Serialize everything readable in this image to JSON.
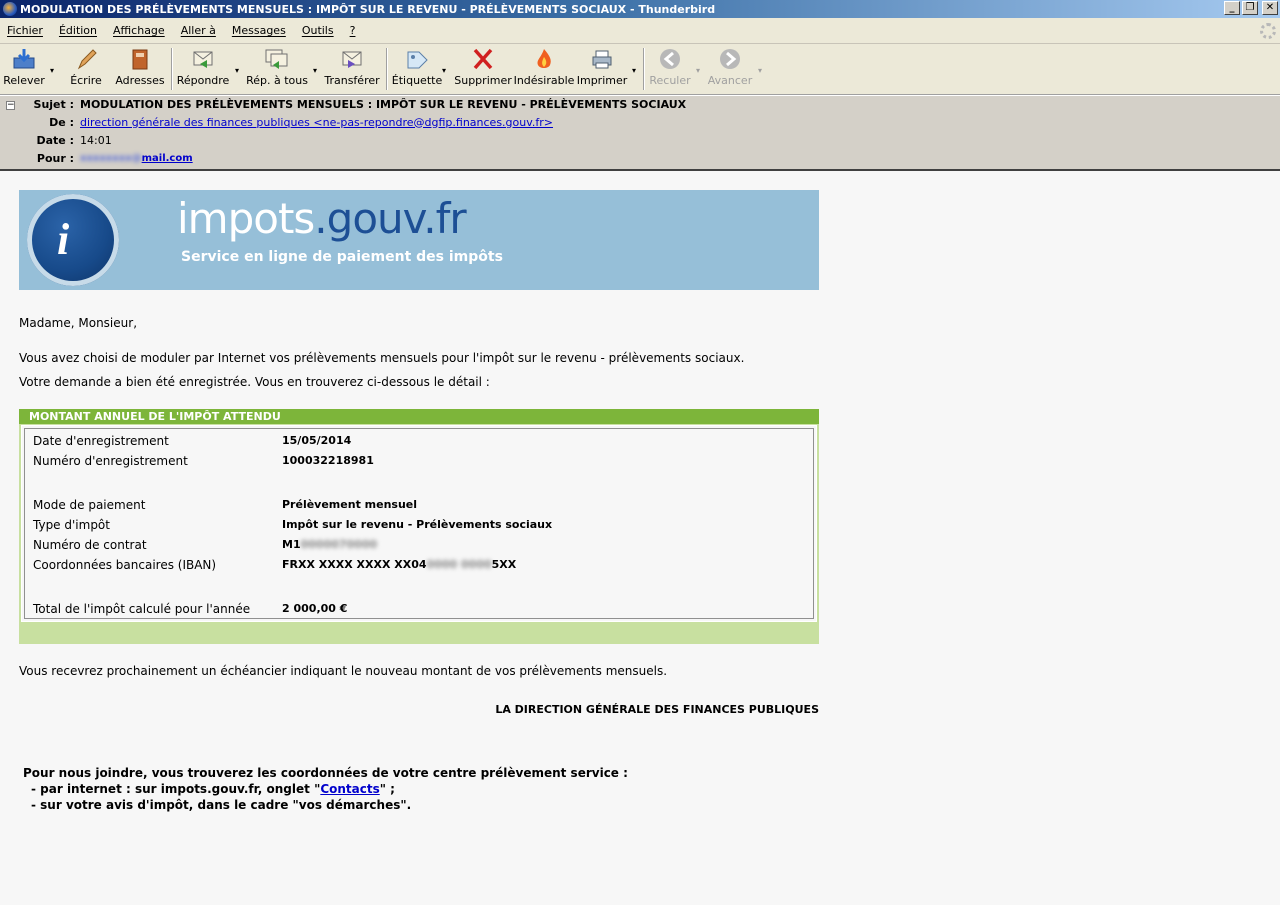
{
  "window": {
    "title": "MODULATION DES PRÉLÈVEMENTS MENSUELS : IMPÔT SUR LE REVENU - PRÉLÈVEMENTS SOCIAUX - Thunderbird",
    "minimize": "_",
    "restore": "❐",
    "close": "✕"
  },
  "menu": [
    "Fichier",
    "Édition",
    "Affichage",
    "Aller à",
    "Messages",
    "Outils",
    "?"
  ],
  "toolbar": {
    "get_mail": "Relever",
    "write": "Écrire",
    "addresses": "Adresses",
    "reply": "Répondre",
    "reply_all": "Rép. à tous",
    "forward": "Transférer",
    "tag": "Étiquette",
    "delete": "Supprimer",
    "junk": "Indésirable",
    "print": "Imprimer",
    "back": "Reculer",
    "forward_nav": "Avancer",
    "dropdown_arrow": "▾"
  },
  "header": {
    "subject_label": "Sujet :",
    "subject": "MODULATION DES PRÉLÈVEMENTS MENSUELS : IMPÔT SUR LE REVENU - PRÉLÈVEMENTS SOCIAUX",
    "from_label": "De :",
    "from": "direction générale des finances publiques <ne-pas-repondre@dgfip.finances.gouv.fr>",
    "date_label": "Date :",
    "date": "14:01",
    "to_label": "Pour :",
    "to_visible": "mail.com",
    "collapse": "−"
  },
  "banner": {
    "brand_part1": "impots",
    "brand_dot": ".",
    "brand_part2": "gouv.fr",
    "logo_letter": "i",
    "tagline": "Service en ligne de paiement des impôts"
  },
  "body": {
    "greeting": "Madame, Monsieur,",
    "line1": "Vous avez choisi de moduler par Internet vos prélèvements mensuels pour l'impôt sur le revenu - prélèvements sociaux.",
    "line2": "Votre demande a bien été enregistrée. Vous en trouverez ci-dessous le détail :",
    "box_title": "MONTANT ANNUEL DE L'IMPÔT ATTENDU",
    "rows": [
      {
        "label": "Date d'enregistrement",
        "value": "15/05/2014"
      },
      {
        "label": "Numéro d'enregistrement",
        "value": "100032218981"
      },
      {
        "label": "Mode de paiement",
        "value": "Prélèvement mensuel"
      },
      {
        "label": "Type d'impôt",
        "value": "Impôt sur le revenu - Prélèvements sociaux"
      },
      {
        "label": "Numéro de contrat",
        "value": "M1"
      },
      {
        "label": "Coordonnées bancaires (IBAN)",
        "value": "FRXX XXXX XXXX XX04",
        "value_end": "5XX"
      },
      {
        "label": "Total de l'impôt calculé pour l'année",
        "value": "2 000,00 €"
      }
    ],
    "notice": "Vous recevrez prochainement un échéancier indiquant le nouveau montant de vos prélèvements mensuels.",
    "signature": "LA DIRECTION GÉNÉRALE DES FINANCES PUBLIQUES",
    "footer_intro": "Pour nous joindre, vous trouverez les coordonnées de votre centre prélèvement service :",
    "footer_line1_pre": "- par internet : sur impots.gouv.fr, onglet \"",
    "footer_link": "Contacts",
    "footer_line1_post": "\" ;",
    "footer_line2": "- sur votre avis d'impôt, dans le cadre \"vos démarches\"."
  },
  "colors": {
    "banner_bg": "#96bfd8",
    "green_header": "#7db53a",
    "green_box": "#c8e0a0",
    "link": "#0000cc"
  }
}
